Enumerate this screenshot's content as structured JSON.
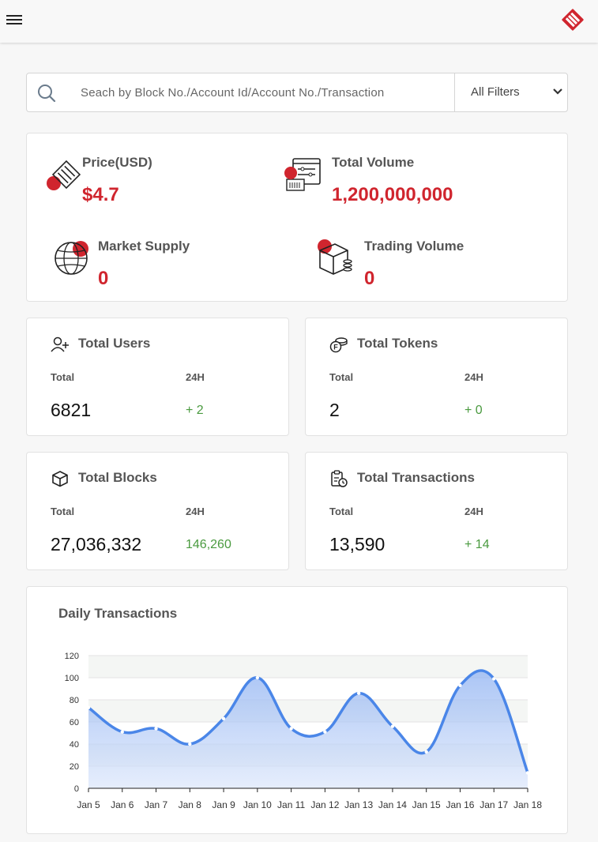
{
  "header": {
    "menu_icon": "hamburger-icon",
    "logo": "brand-logo"
  },
  "search": {
    "placeholder": "Seach by Block No./Account Id/Account No./Transaction",
    "filter_label": "All Filters"
  },
  "overview": {
    "price": {
      "title": "Price(USD)",
      "value": "$4.7"
    },
    "total_volume": {
      "title": "Total Volume",
      "value": "1,200,000,000"
    },
    "market_supply": {
      "title": "Market Supply",
      "value": "0"
    },
    "trading_volume": {
      "title": "Trading Volume",
      "value": "0"
    }
  },
  "stats": {
    "users": {
      "title": "Total Users",
      "total_label": "Total",
      "h24_label": "24H",
      "total": "6821",
      "h24": "+ 2"
    },
    "tokens": {
      "title": "Total Tokens",
      "total_label": "Total",
      "h24_label": "24H",
      "total": "2",
      "h24": "+ 0"
    },
    "blocks": {
      "title": "Total Blocks",
      "total_label": "Total",
      "h24_label": "24H",
      "total": "27,036,332",
      "h24": "146,260"
    },
    "transactions": {
      "title": "Total Transactions",
      "total_label": "Total",
      "h24_label": "24H",
      "total": "13,590",
      "h24": "+ 14"
    }
  },
  "colors": {
    "accent": "#d0252e",
    "positive": "#4a9a3f",
    "line": "#4a86e8"
  },
  "chart_title": "Daily Transactions",
  "chart_data": {
    "type": "area",
    "title": "Daily Transactions",
    "xlabel": "",
    "ylabel": "",
    "ylim": [
      0,
      120
    ],
    "yticks": [
      0,
      20,
      40,
      60,
      80,
      100,
      120
    ],
    "categories": [
      "Jan 5",
      "Jan 6",
      "Jan 7",
      "Jan 8",
      "Jan 9",
      "Jan 10",
      "Jan 11",
      "Jan 12",
      "Jan 13",
      "Jan 14",
      "Jan 15",
      "Jan 16",
      "Jan 17",
      "Jan 18"
    ],
    "values": [
      73,
      51,
      54,
      40,
      63,
      100,
      54,
      51,
      86,
      56,
      33,
      93,
      99,
      14
    ],
    "grid": "horizontal bands"
  }
}
